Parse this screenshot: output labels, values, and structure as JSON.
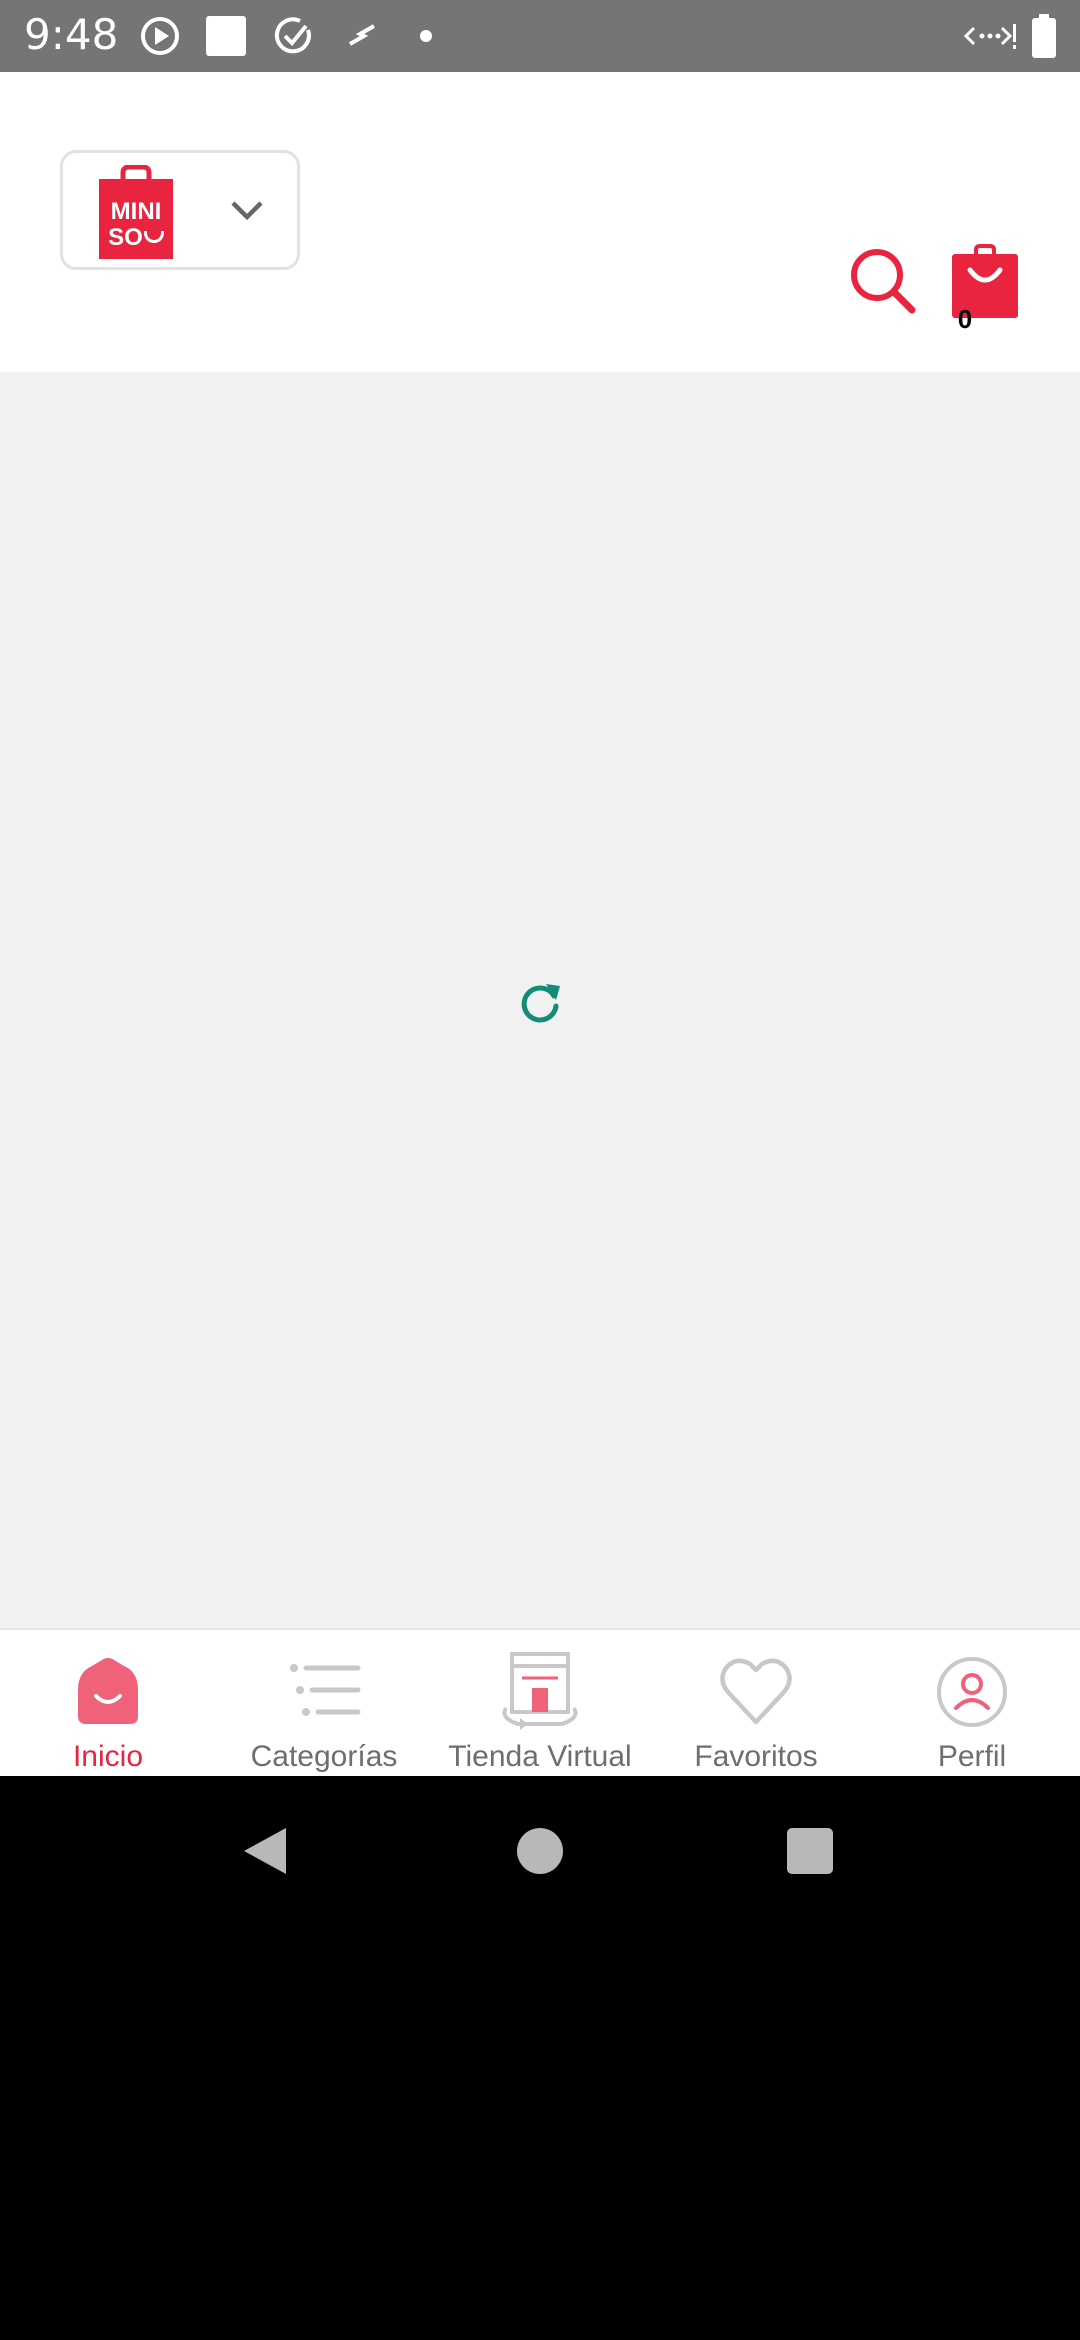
{
  "status_bar": {
    "time": "9:48",
    "icons": [
      "play-circle-icon",
      "white-square-icon",
      "check-sync-icon",
      "swipe-icon",
      "dot-icon",
      "data-arrows-icon",
      "battery-icon"
    ]
  },
  "header": {
    "logo_text_line1": "MINI",
    "logo_text_line2": "SO",
    "cart_count": "0",
    "brand_color": "#e8243f"
  },
  "content": {
    "loading_icon": "refresh-icon",
    "loading_color": "#138b77"
  },
  "bottom_nav": {
    "items": [
      {
        "label": "Inicio",
        "icon": "home-icon",
        "active": true
      },
      {
        "label": "Categorías",
        "icon": "list-icon",
        "active": false
      },
      {
        "label": "Tienda Virtual",
        "icon": "storefront-icon",
        "active": false
      },
      {
        "label": "Favoritos",
        "icon": "heart-icon",
        "active": false
      },
      {
        "label": "Perfil",
        "icon": "profile-icon",
        "active": false
      }
    ]
  },
  "system_nav": {
    "buttons": [
      "back-icon",
      "home-circle-icon",
      "recents-icon"
    ]
  }
}
